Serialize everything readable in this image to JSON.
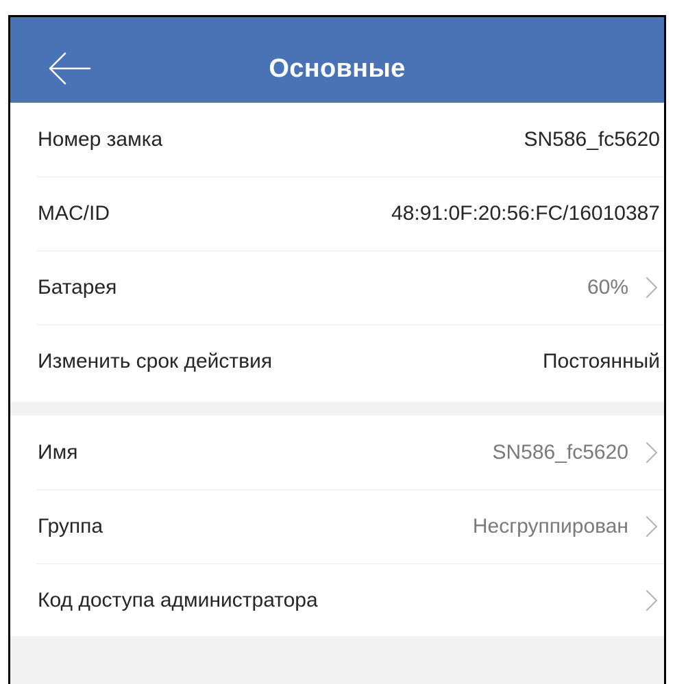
{
  "header": {
    "title": "Основные",
    "back_icon": "arrow-left-icon",
    "background_color": "#4a73b6"
  },
  "info_section": {
    "rows": [
      {
        "label": "Номер замка",
        "value": "SN586_fc5620"
      },
      {
        "label": "MAC/ID",
        "value": "48:91:0F:20:56:FC/16010387"
      },
      {
        "label": "Батарея",
        "value": "60%",
        "icon": "chevron-right-icon"
      },
      {
        "label": "Изменить срок действия",
        "value": "Постоянный"
      }
    ]
  },
  "settings_section": {
    "rows": [
      {
        "label": "Имя",
        "value": "SN586_fc5620",
        "icon": "chevron-right-icon"
      },
      {
        "label": "Группа",
        "value": "Несгруппирован",
        "icon": "chevron-right-icon"
      },
      {
        "label": "Код доступа администратора",
        "value": "",
        "icon": "chevron-right-icon"
      }
    ]
  }
}
